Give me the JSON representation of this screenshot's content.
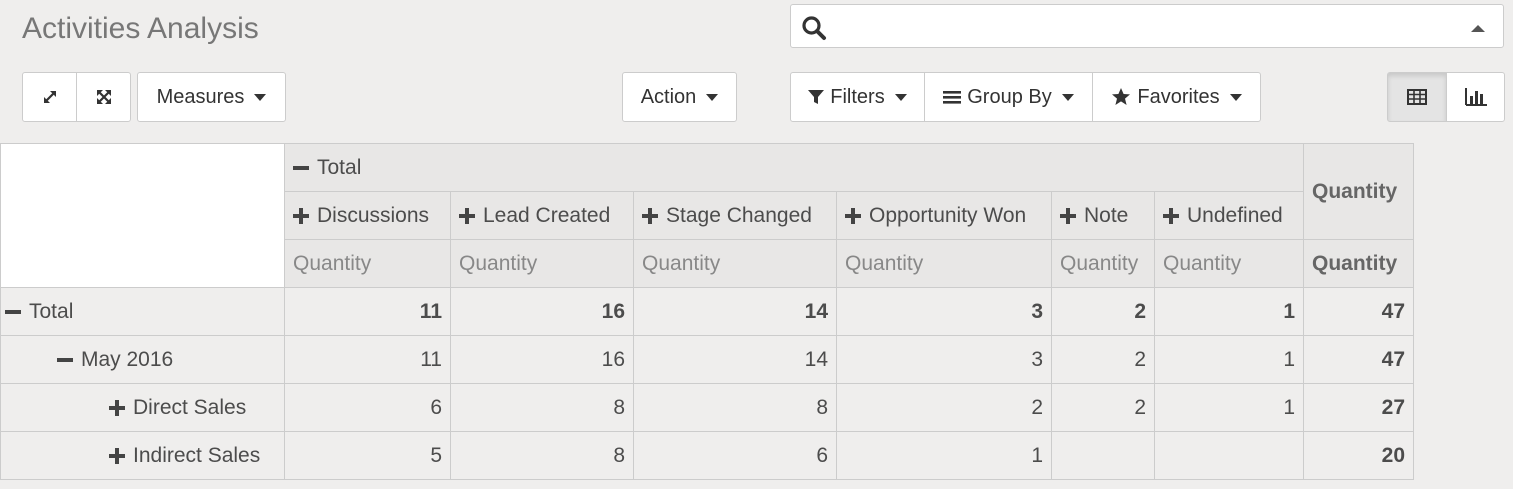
{
  "page": {
    "title": "Activities Analysis"
  },
  "search": {
    "value": "",
    "placeholder": ""
  },
  "toolbar": {
    "expand_icon": "expand-icon",
    "fullscreen_icon": "arrows-out-icon",
    "measures_label": "Measures",
    "action_label": "Action",
    "filters_label": "Filters",
    "groupby_label": "Group By",
    "favorites_label": "Favorites",
    "pivot_view_icon": "table-icon",
    "graph_view_icon": "bar-chart-icon"
  },
  "pivot": {
    "col_total_label": "Total",
    "columns": [
      "Discussions",
      "Lead Created",
      "Stage Changed",
      "Opportunity Won",
      "Note",
      "Undefined"
    ],
    "measure_label": "Quantity",
    "total_measure_label": "Quantity",
    "rows": [
      {
        "label": "Total",
        "level": 0,
        "expanded": true,
        "bold": true,
        "values": [
          "11",
          "16",
          "14",
          "3",
          "2",
          "1"
        ],
        "total": "47"
      },
      {
        "label": "May 2016",
        "level": 1,
        "expanded": true,
        "bold": false,
        "values": [
          "11",
          "16",
          "14",
          "3",
          "2",
          "1"
        ],
        "total": "47"
      },
      {
        "label": "Direct Sales",
        "level": 2,
        "expanded": false,
        "bold": false,
        "values": [
          "6",
          "8",
          "8",
          "2",
          "2",
          "1"
        ],
        "total": "27"
      },
      {
        "label": "Indirect Sales",
        "level": 2,
        "expanded": false,
        "bold": false,
        "values": [
          "5",
          "8",
          "6",
          "1",
          "",
          ""
        ],
        "total": "20"
      }
    ]
  }
}
